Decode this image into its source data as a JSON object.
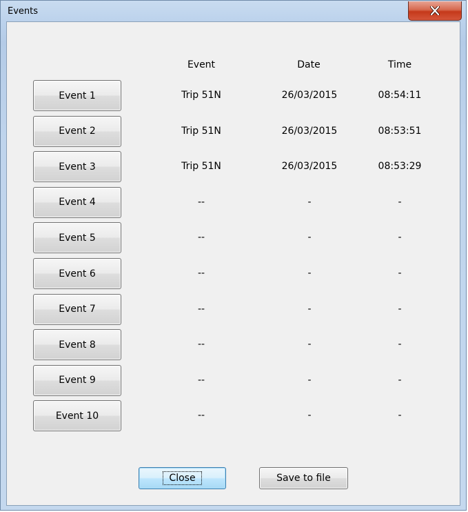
{
  "window": {
    "title": "Events",
    "close_icon": "close-x-icon"
  },
  "table": {
    "headers": {
      "event": "Event",
      "date": "Date",
      "time": "Time"
    },
    "rows": [
      {
        "button": "Event 1",
        "event": "Trip 51N",
        "date": "26/03/2015",
        "time": "08:54:11"
      },
      {
        "button": "Event 2",
        "event": "Trip 51N",
        "date": "26/03/2015",
        "time": "08:53:51"
      },
      {
        "button": "Event 3",
        "event": "Trip 51N",
        "date": "26/03/2015",
        "time": "08:53:29"
      },
      {
        "button": "Event 4",
        "event": "--",
        "date": "-",
        "time": "-"
      },
      {
        "button": "Event 5",
        "event": "--",
        "date": "-",
        "time": "-"
      },
      {
        "button": "Event 6",
        "event": "--",
        "date": "-",
        "time": "-"
      },
      {
        "button": "Event 7",
        "event": "--",
        "date": "-",
        "time": "-"
      },
      {
        "button": "Event 8",
        "event": "--",
        "date": "-",
        "time": "-"
      },
      {
        "button": "Event 9",
        "event": "--",
        "date": "-",
        "time": "-"
      },
      {
        "button": "Event 10",
        "event": "--",
        "date": "-",
        "time": "-"
      }
    ]
  },
  "buttons": {
    "close": "Close",
    "save": "Save to file"
  }
}
